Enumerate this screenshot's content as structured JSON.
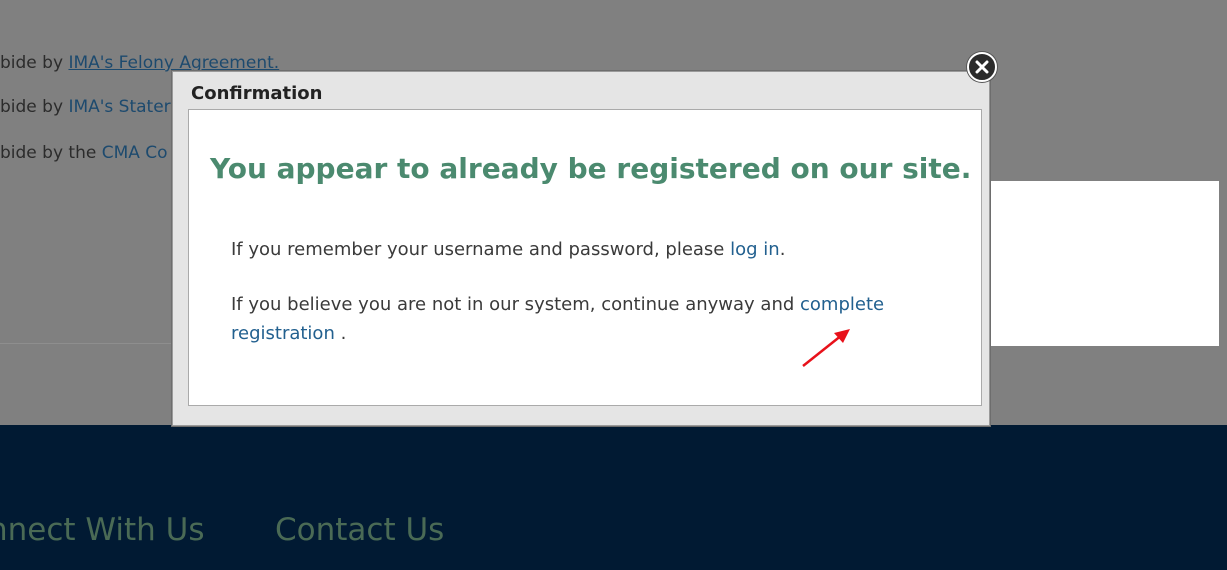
{
  "background": {
    "lines": [
      {
        "prefix": "bide by ",
        "link": "IMA's Felony Agreement."
      },
      {
        "prefix": "bide by ",
        "link": "IMA's Stater"
      },
      {
        "prefix": "bide by the ",
        "link": "CMA Co"
      }
    ]
  },
  "footer": {
    "links": [
      "nnect With Us",
      "Contact Us"
    ]
  },
  "modal": {
    "title": "Confirmation",
    "headline": "You appear to already be registered on our site.",
    "para1_text": "If you remember your username and password, please ",
    "para1_link": "log in",
    "para1_end": ".",
    "para2_text": "If you believe you are not in our system, continue anyway and ",
    "para2_link": "complete registration",
    "para2_end": " .",
    "close_icon": "close-icon"
  },
  "colors": {
    "headline": "#4b8a6f",
    "link": "#22608f",
    "footer_bg": "#011a33",
    "annotation_arrow": "#e8111a"
  }
}
